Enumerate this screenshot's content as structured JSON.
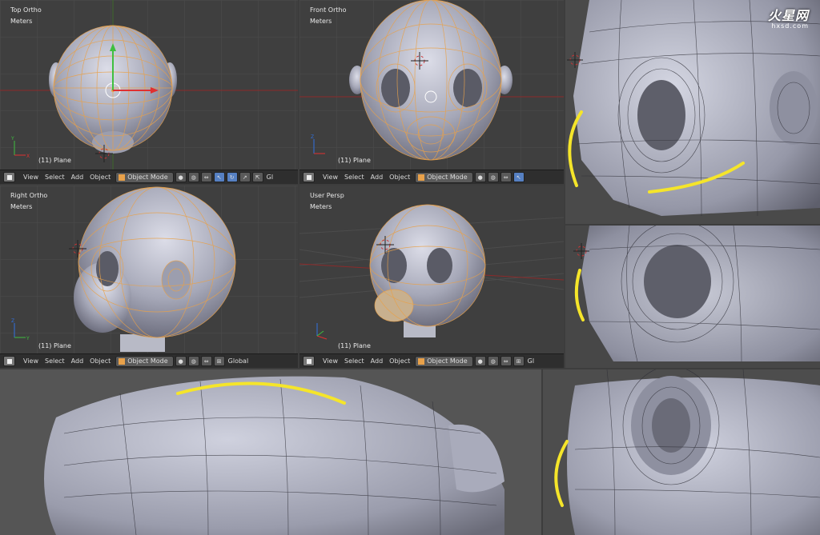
{
  "viewports": [
    {
      "title": "Top Ortho",
      "units": "Meters",
      "object": "(11) Plane"
    },
    {
      "title": "Front Ortho",
      "units": "Meters",
      "object": "(11) Plane"
    },
    {
      "title": "Right Ortho",
      "units": "Meters",
      "object": "(11) Plane"
    },
    {
      "title": "User Persp",
      "units": "Meters",
      "object": "(11) Plane"
    }
  ],
  "header": {
    "menus": [
      "View",
      "Select",
      "Add",
      "Object"
    ],
    "mode_label": "Object Mode",
    "orientation_label": "Global",
    "orientation_short": "Gl"
  },
  "watermark": {
    "brand": "火星网",
    "url": "hxsd.com"
  },
  "colors": {
    "viewport_bg": "#3f3f3f",
    "wire_selected": "#e8a14a",
    "highlight_stroke": "#f5e52a",
    "mesh_surface": "#b4b6c4",
    "header_bg": "#2e2e2e",
    "active_button": "#5680c2"
  }
}
